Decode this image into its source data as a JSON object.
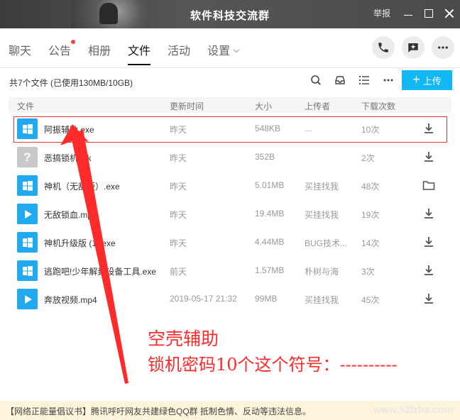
{
  "window": {
    "title": "软件科技交流群",
    "report_label": "举报"
  },
  "tabs": [
    {
      "label": "聊天"
    },
    {
      "label": "公告"
    },
    {
      "label": "相册"
    },
    {
      "label": "文件"
    },
    {
      "label": "活动"
    },
    {
      "label": "设置"
    }
  ],
  "toolbar": {
    "file_count": "共7个文件 (已使用130MB/10GB)",
    "upload_label": "上传"
  },
  "table": {
    "columns": [
      "文件",
      "更新时间",
      "大小",
      "上传者",
      "下载次数"
    ],
    "rows": [
      {
        "name": "阿振辅助.exe",
        "time": "昨天",
        "size": "548KB",
        "uploader": "...",
        "downloads": "10次",
        "type": "exe",
        "action": "download-icon"
      },
      {
        "name": "恶搞锁机.lnk",
        "time": "昨天",
        "size": "352B",
        "uploader": "",
        "downloads": "2次",
        "type": "lnk",
        "action": "download-icon"
      },
      {
        "name": "神机（无敌版）.exe",
        "time": "昨天",
        "size": "5.01MB",
        "uploader": "买挂找我",
        "downloads": "48次",
        "type": "exe",
        "action": "folder-icon"
      },
      {
        "name": "无敌锁血.mp4",
        "time": "昨天",
        "size": "19.4MB",
        "uploader": "买挂找我",
        "downloads": "19次",
        "type": "mp4",
        "action": "download-icon"
      },
      {
        "name": "神机升级版 (1).exe",
        "time": "昨天",
        "size": "4.44MB",
        "uploader": "BUG技术...",
        "downloads": "14次",
        "type": "exe",
        "action": "download-icon"
      },
      {
        "name": "逃跑吧!少年解封设备工具.exe",
        "time": "前天",
        "size": "1.57MB",
        "uploader": "朴树与海",
        "downloads": "3次",
        "type": "exe",
        "action": "download-icon"
      },
      {
        "name": "奔放视频.mp4",
        "time": "2019-05-17 21:32",
        "size": "99MB",
        "uploader": "买挂找我",
        "downloads": "45次",
        "type": "mp4",
        "action": "download-icon"
      }
    ]
  },
  "annotation": {
    "line1": "空壳辅助",
    "line2": "锁机密码10个这个符号：----------",
    "color": "#ff2a2a"
  },
  "footer": {
    "notice": "【网络正能量倡议书】腾讯呼吁网友共建绿色QQ群 抵制色情、反动等违法信息。",
    "watermark": "www.52fzba.com"
  },
  "colors": {
    "accent": "#12b7f5",
    "titlebar": "#4a4a4a",
    "highlight": "#e83a3a",
    "notice_bg": "#fcf5dc"
  }
}
